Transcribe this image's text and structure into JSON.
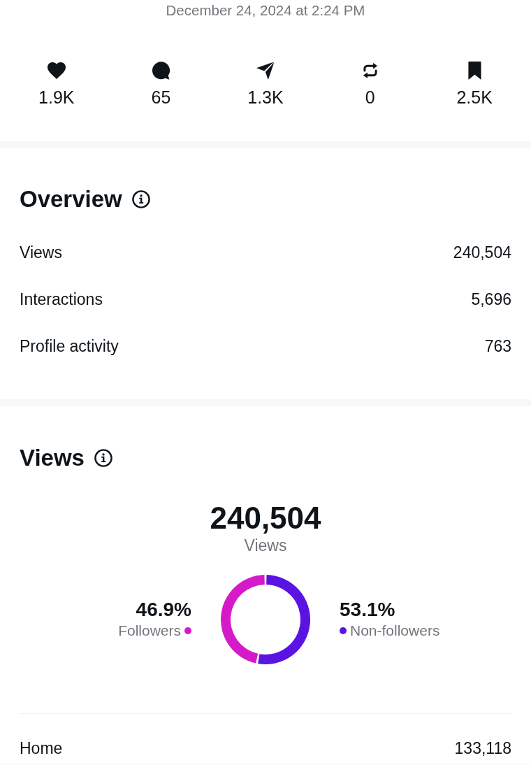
{
  "post": {
    "timestamp": "December 24, 2024 at 2:24 PM"
  },
  "engagement": [
    {
      "value": "1.9K"
    },
    {
      "value": "65"
    },
    {
      "value": "1.3K"
    },
    {
      "value": "0"
    },
    {
      "value": "2.5K"
    }
  ],
  "overview": {
    "heading": "Overview",
    "rows": [
      {
        "label": "Views",
        "value": "240,504"
      },
      {
        "label": "Interactions",
        "value": "5,696"
      },
      {
        "label": "Profile activity",
        "value": "763"
      }
    ]
  },
  "views": {
    "heading": "Views",
    "total": "240,504",
    "total_label": "Views",
    "chart_data": {
      "type": "donut",
      "categories": [
        "Followers",
        "Non-followers"
      ],
      "values": [
        46.9,
        53.1
      ],
      "colors": [
        "#d41ac9",
        "#5b13e2"
      ],
      "value_labels": [
        "46.9%",
        "53.1%"
      ]
    },
    "sources": [
      {
        "label": "Home",
        "value": "133,118"
      }
    ]
  }
}
